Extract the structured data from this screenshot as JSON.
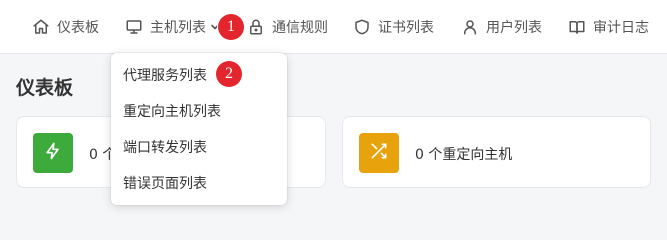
{
  "nav": {
    "items": [
      {
        "label": "仪表板",
        "icon": "home-icon"
      },
      {
        "label": "主机列表",
        "icon": "monitor-icon",
        "open": true
      },
      {
        "label": "通信规则",
        "icon": "lock-icon"
      },
      {
        "label": "证书列表",
        "icon": "shield-icon"
      },
      {
        "label": "用户列表",
        "icon": "user-icon"
      },
      {
        "label": "审计日志",
        "icon": "book-icon"
      }
    ]
  },
  "badges": {
    "one": "1",
    "two": "2"
  },
  "page": {
    "title": "仪表板"
  },
  "cards": [
    {
      "text": "0 个",
      "icon": "bolt-icon",
      "color": "#3cab3c"
    },
    {
      "text": "0 个重定向主机",
      "icon": "shuffle-icon",
      "color": "#e8a20c"
    }
  ],
  "dropdown": {
    "items": [
      {
        "label": "代理服务列表"
      },
      {
        "label": "重定向主机列表"
      },
      {
        "label": "端口转发列表"
      },
      {
        "label": "错误页面列表"
      }
    ]
  }
}
